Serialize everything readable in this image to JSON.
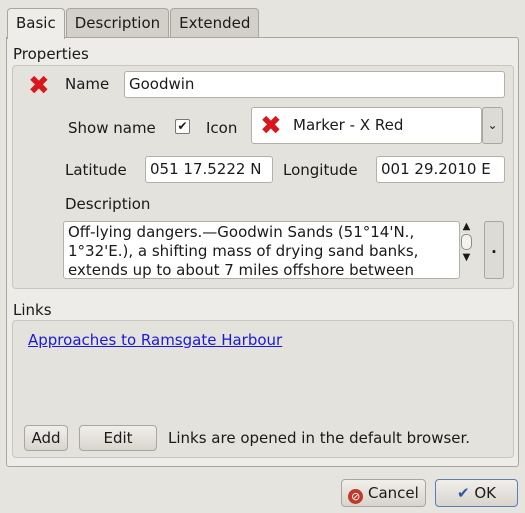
{
  "tabs": [
    "Basic",
    "Description",
    "Extended"
  ],
  "properties": {
    "title": "Properties",
    "name_label": "Name",
    "name_value": "Goodwin",
    "show_name_label": "Show name",
    "show_name_checked": true,
    "icon_label": "Icon",
    "icon_value": "Marker - X Red",
    "latitude_label": "Latitude",
    "latitude_value": "051 17.5222 N",
    "longitude_label": "Longitude",
    "longitude_value": "001 29.2010 E",
    "description_label": "Description",
    "description_lines": [
      "Off-lying dangers.—Goodwin Sands (51°14'N.,",
      "1°32'E.), a shifting mass of drying sand banks,",
      "extends up to about 7 miles offshore between"
    ],
    "more_button": "."
  },
  "links": {
    "title": "Links",
    "items": [
      "Approaches to Ramsgate Harbour"
    ],
    "add_label": "Add",
    "edit_label": "Edit",
    "note": "Links are opened in the default browser."
  },
  "dialog": {
    "cancel_label": "Cancel",
    "ok_label": "OK"
  },
  "colors": {
    "icon_red": "#d9161c",
    "link": "#1a1ad6"
  }
}
